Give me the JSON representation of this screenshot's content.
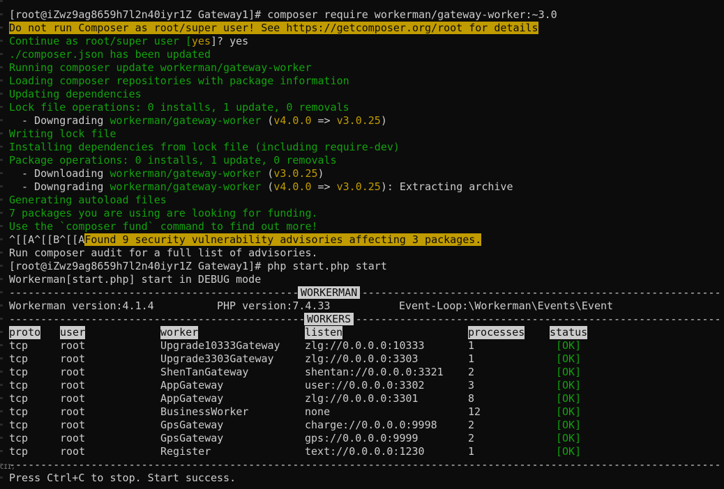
{
  "prompt1": "[root@iZwz9ag8659h7l2n40iyr1Z Gateway1]# composer require workerman/gateway-worker:~3.0",
  "warning": "Do not run Composer as root/super user! See https://getcomposer.org/root for details",
  "continue_prompt": "Continue as root/super user [",
  "continue_default": "yes",
  "continue_tail": "]? yes",
  "log": {
    "composer_updated": "./composer.json has been updated",
    "running_update": "Running composer update workerman/gateway-worker",
    "loading_repos": "Loading composer repositories with package information",
    "updating_deps": "Updating dependencies",
    "lock_ops": "Lock file operations: 0 installs, 1 update, 0 removals",
    "writing_lock": "Writing lock file",
    "installing_deps": "Installing dependencies from lock file (including require-dev)",
    "package_ops": "Package operations: 0 installs, 1 update, 0 removals",
    "generating_autoload": "Generating autoload files",
    "funding": "7 packages you are using are looking for funding.",
    "fund_cmd": "Use the `composer fund` command to find out more!",
    "escape_seq": "^[[A^[[B^[[A",
    "advisories": "Found 9 security vulnerability advisories affecting 3 packages.",
    "audit": "Run composer audit for a full list of advisories."
  },
  "ops": {
    "downgrade_prefix": "  - Downgrading ",
    "download_prefix": "  - Downloading ",
    "pkg": "workerman/gateway-worker",
    "paren_open": " (",
    "paren_close": ")",
    "ver_from": "v4.0.0",
    "arrow": " => ",
    "ver_to": "v3.0.25",
    "extract_tail": "): Extracting archive"
  },
  "prompt2": "[root@iZwz9ag8659h7l2n40iyr1Z Gateway1]# php start.php start",
  "debug_line": "Workerman[start.php] start in DEBUG mode",
  "dashes": "---------------------------------------------------------------------------------------------------------------------------------",
  "sections": {
    "workerman": "WORKERMAN",
    "workers": "WORKERS"
  },
  "versions": {
    "workerman": "Workerman version:4.1.4",
    "php": "PHP version:7.4.33",
    "event_loop": "Event-Loop:\\Workerman\\Events\\Event"
  },
  "table": {
    "headers": [
      "proto",
      "user",
      "worker",
      "listen",
      "processes",
      "status"
    ],
    "rows": [
      [
        "tcp",
        "root",
        "Upgrade10333Gateway",
        "zlg://0.0.0.0:10333",
        "1",
        "[OK]"
      ],
      [
        "tcp",
        "root",
        "Upgrade3303Gateway",
        "zlg://0.0.0.0:3303",
        "1",
        "[OK]"
      ],
      [
        "tcp",
        "root",
        "ShenTanGateway",
        "shentan://0.0.0.0:3321",
        "2",
        "[OK]"
      ],
      [
        "tcp",
        "root",
        "AppGateway",
        "user://0.0.0.0:3302",
        "3",
        "[OK]"
      ],
      [
        "tcp",
        "root",
        "AppGateway",
        "zlg://0.0.0.0:3301",
        "8",
        "[OK]"
      ],
      [
        "tcp",
        "root",
        "BusinessWorker",
        "none",
        "12",
        "[OK]"
      ],
      [
        "tcp",
        "root",
        "GpsGateway",
        "charge://0.0.0.0:9998",
        "2",
        "[OK]"
      ],
      [
        "tcp",
        "root",
        "GpsGateway",
        "gps://0.0.0.0:9999",
        "2",
        "[OK]"
      ],
      [
        "tcp",
        "root",
        "Register",
        "text://0.0.0.0:1230",
        "1",
        "[OK]"
      ]
    ]
  },
  "footer": "Press Ctrl+C to stop. Start success.",
  "edge_fragment": "CII,"
}
